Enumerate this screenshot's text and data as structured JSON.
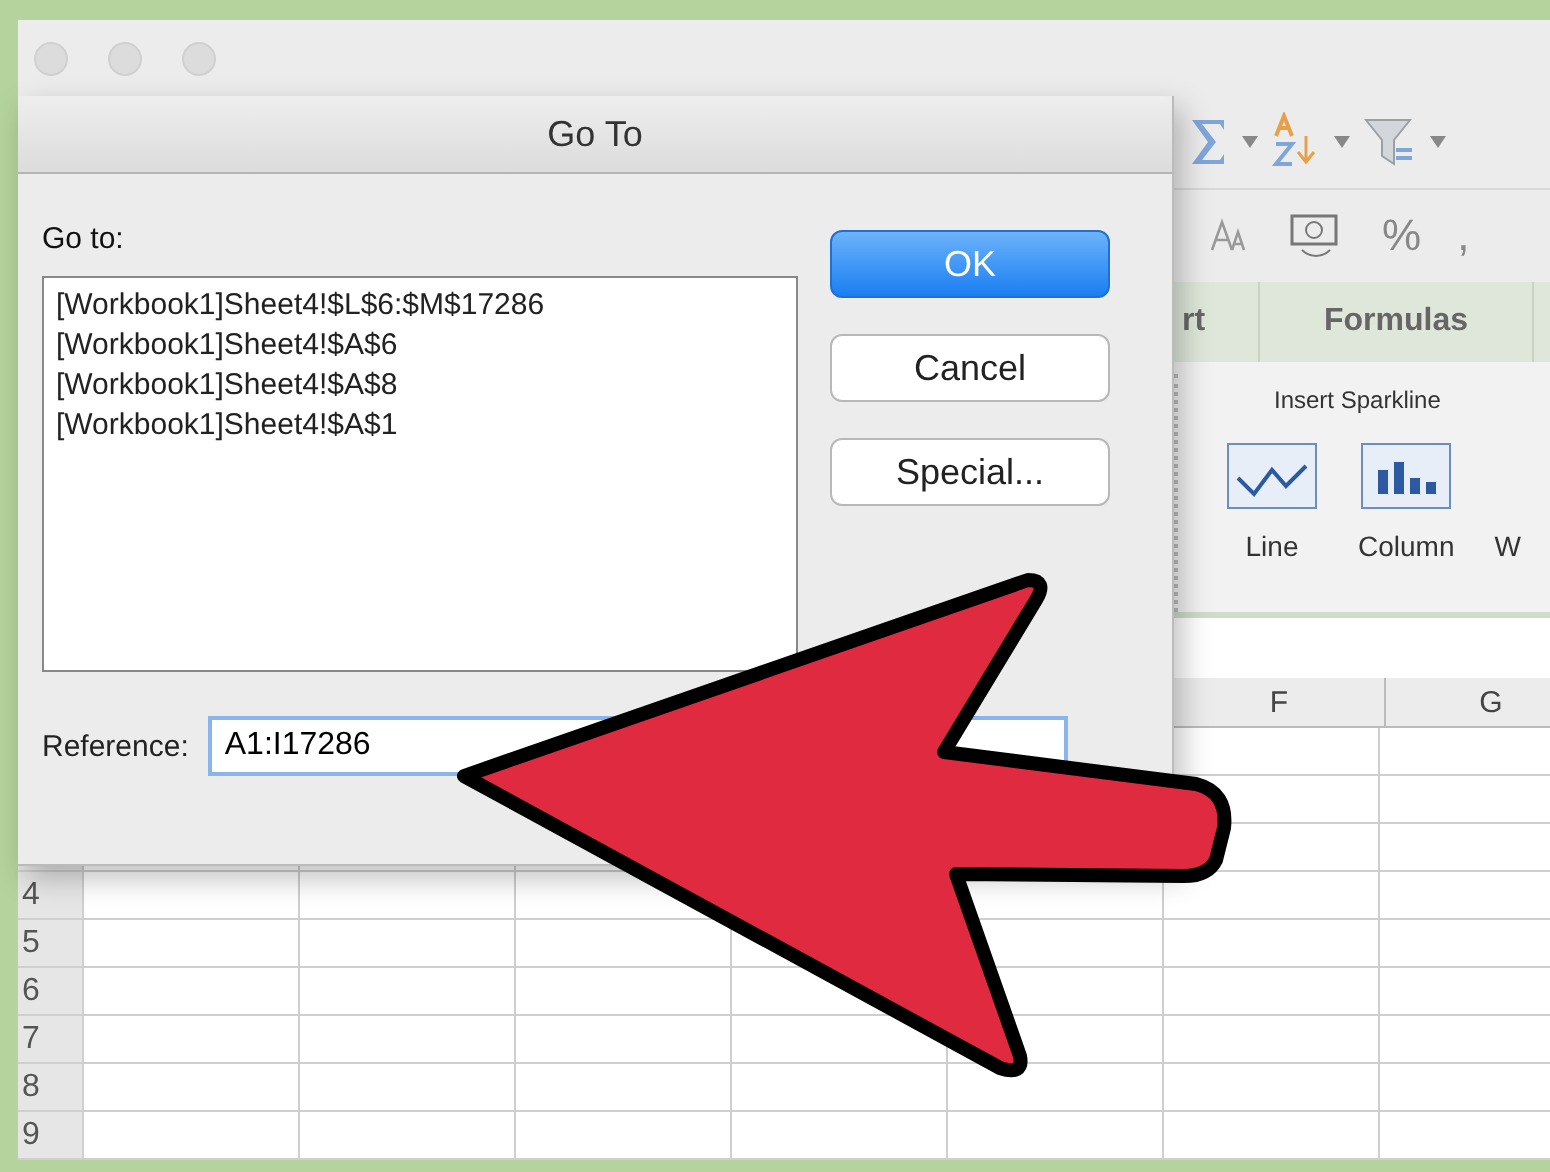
{
  "dialog": {
    "title": "Go To",
    "goto_label": "Go to:",
    "list_items": [
      {
        "text": "[Workbook1]Sheet4!$L$6:$M$17286",
        "selected": false
      },
      {
        "text": "[Workbook1]Sheet4!$A$6",
        "selected": false
      },
      {
        "text": "[Workbook1]Sheet4!$A$8",
        "selected": false
      },
      {
        "text": "[Workbook1]Sheet4!$A$1",
        "selected": false
      }
    ],
    "buttons": [
      {
        "label": "OK",
        "kind": "default"
      },
      {
        "label": "Cancel",
        "kind": "normal"
      },
      {
        "label": "Special...",
        "kind": "normal"
      }
    ],
    "reference": {
      "label": "Reference:",
      "value": "A1:I17286"
    }
  },
  "toolbar": {
    "symbols": [
      "%",
      ","
    ]
  },
  "ribbon_tabs": [
    {
      "label": "rt",
      "selected": false
    },
    {
      "label": "Formulas",
      "selected": false
    }
  ],
  "ribbon_group": {
    "title": "Insert Sparkline",
    "buttons": [
      {
        "label": "Line",
        "kind": "line"
      },
      {
        "label": "Column",
        "kind": "column"
      },
      {
        "label": "W",
        "kind": "partial"
      }
    ]
  },
  "column_headers": [
    "F",
    "G"
  ],
  "row_numbers": [
    "4",
    "5",
    "6",
    "7",
    "8",
    "9"
  ]
}
